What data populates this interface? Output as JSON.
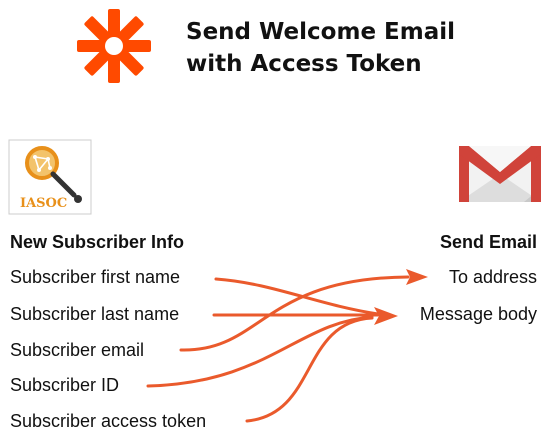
{
  "title": {
    "line1": "Send Welcome Email",
    "line2": "with Access Token"
  },
  "logos": {
    "zap": "zapier-asterisk-icon",
    "left_app": "IASOC",
    "right_app": "gmail-envelope-icon"
  },
  "colors": {
    "accent": "#FF4A00",
    "arrow": "#EA5A2C",
    "iasoc_orange": "#E8901A",
    "gmail_red": "#D0433A"
  },
  "left": {
    "heading": "New Subscriber Info",
    "fields": [
      "Subscriber first name",
      "Subscriber last name",
      "Subscriber email",
      "Subscriber ID",
      "Subscriber access token"
    ]
  },
  "right": {
    "heading": "Send Email",
    "fields": [
      "To address",
      "Message body"
    ]
  }
}
